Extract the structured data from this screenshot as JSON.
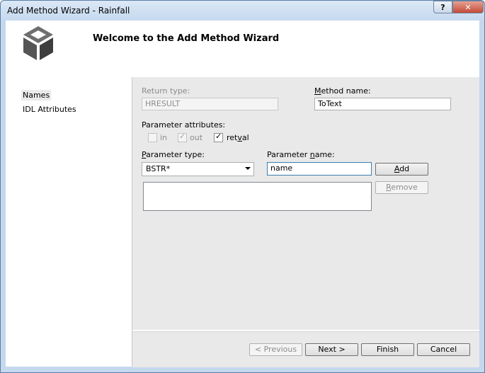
{
  "window": {
    "title": "Add Method Wizard - Rainfall",
    "help_label": "?",
    "close_label": "✕"
  },
  "header": {
    "title": "Welcome to the Add Method Wizard",
    "logo_icon": "cube-icon"
  },
  "nav": {
    "items": [
      {
        "label": "Names",
        "selected": true
      },
      {
        "label": "IDL Attributes",
        "selected": false
      }
    ]
  },
  "form": {
    "return_type_label": "Return type:",
    "return_type_value": "HRESULT",
    "method_name_label_pre": "",
    "method_name_label_key": "M",
    "method_name_label_post": "ethod name:",
    "method_name_value": "ToText",
    "param_attr_label": "Parameter attributes:",
    "cb_in_label": "in",
    "cb_out_label": "out",
    "cb_retval_label_pre": "ret",
    "cb_retval_label_key": "v",
    "cb_retval_label_post": "al",
    "param_type_label_pre": "",
    "param_type_label_key": "P",
    "param_type_label_post": "arameter type:",
    "param_type_value": "BSTR*",
    "param_name_label_pre": "Parameter ",
    "param_name_label_key": "n",
    "param_name_label_post": "ame:",
    "param_name_value": "name",
    "add_label_key": "A",
    "add_label_post": "dd",
    "remove_label_key": "R",
    "remove_label_post": "emove"
  },
  "footer": {
    "previous": "< Previous",
    "next": "Next >",
    "finish": "Finish",
    "cancel": "Cancel"
  }
}
